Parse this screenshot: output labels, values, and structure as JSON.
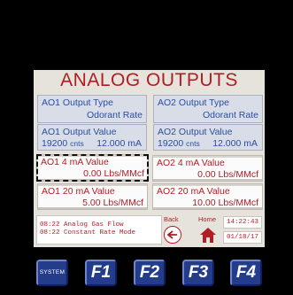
{
  "screen": {
    "title": "ANALOG OUTPUTS",
    "ao1_type": {
      "label": "AO1 Output Type",
      "value": "Odorant Rate"
    },
    "ao2_type": {
      "label": "AO2 Output Type",
      "value": "Odorant Rate"
    },
    "ao1_value": {
      "label": "AO1 Output Value",
      "counts": "19200",
      "counts_unit": "cnts",
      "ma": "12.000 mA"
    },
    "ao2_value": {
      "label": "AO2 Output Value",
      "counts": "19200",
      "counts_unit": "cnts",
      "ma": "12.000 mA"
    },
    "ao1_4ma": {
      "label": "AO1 4 mA Value",
      "value": "0.00 Lbs/MMcf"
    },
    "ao2_4ma": {
      "label": "AO2 4 mA Value",
      "value": "0.00 Lbs/MMcf"
    },
    "ao1_20ma": {
      "label": "AO1 20 mA Value",
      "value": "5.00 Lbs/MMcf"
    },
    "ao2_20ma": {
      "label": "AO2 20 mA Value",
      "value": "10.00 Lbs/MMcf"
    },
    "status_lines": [
      "08:22 Analog Gas Flow",
      "08:22 Constant Rate Mode"
    ],
    "back_label": "Back",
    "home_label": "Home",
    "time": "14:22:43",
    "date": "01/18/17"
  },
  "function_keys": {
    "system": "SYSTEM",
    "f1": "F1",
    "f2": "F2",
    "f3": "F3",
    "f4": "F4"
  },
  "colors": {
    "accent_red": "#b01e23",
    "label_blue": "#2a4fa0",
    "key_blue": "#243c8c"
  }
}
